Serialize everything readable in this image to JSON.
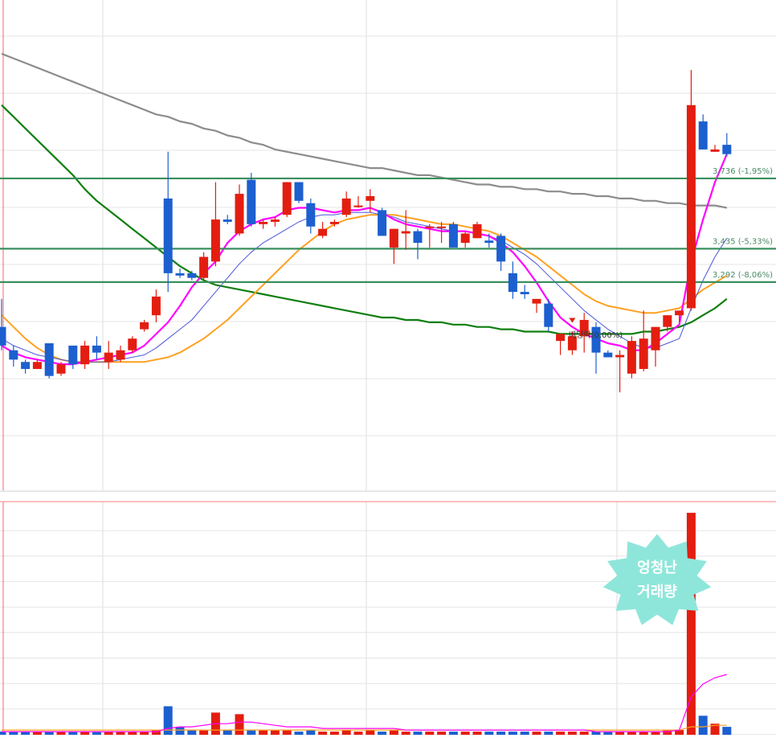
{
  "chart_data": [
    {
      "type": "candlestick",
      "title": "",
      "colors": {
        "up": "#e31e10",
        "down": "#1c5fcf",
        "ma_magenta": "#ff00ff",
        "ma_blue": "#4b55d8",
        "ma_orange": "#ffa020",
        "ma_green": "#0f7f0f",
        "ma_gray": "#8c8c8c",
        "level_line": "#3a8f5e"
      },
      "ohlc": [
        [
          3.1,
          3.22,
          3.0,
          3.02
        ],
        [
          3.0,
          3.02,
          2.93,
          2.96
        ],
        [
          2.95,
          2.96,
          2.9,
          2.92
        ],
        [
          2.92,
          2.96,
          2.92,
          2.95
        ],
        [
          3.03,
          3.03,
          2.88,
          2.89
        ],
        [
          2.9,
          2.95,
          2.89,
          2.94
        ],
        [
          3.02,
          3.02,
          2.92,
          2.94
        ],
        [
          2.94,
          3.04,
          2.92,
          3.02
        ],
        [
          3.02,
          3.06,
          2.96,
          2.99
        ],
        [
          2.95,
          3.04,
          2.92,
          2.99
        ],
        [
          2.96,
          3.02,
          2.95,
          3.0
        ],
        [
          3.0,
          3.06,
          2.99,
          3.05
        ],
        [
          3.09,
          3.13,
          3.08,
          3.12
        ],
        [
          3.15,
          3.26,
          3.12,
          3.23
        ],
        [
          3.65,
          3.85,
          3.25,
          3.33
        ],
        [
          3.33,
          3.35,
          3.31,
          3.32
        ],
        [
          3.33,
          3.34,
          3.3,
          3.31
        ],
        [
          3.31,
          3.42,
          3.3,
          3.4
        ],
        [
          3.38,
          3.72,
          3.36,
          3.56
        ],
        [
          3.56,
          3.58,
          3.54,
          3.55
        ],
        [
          3.5,
          3.71,
          3.49,
          3.67
        ],
        [
          3.73,
          3.76,
          3.53,
          3.54
        ],
        [
          3.54,
          3.56,
          3.52,
          3.55
        ],
        [
          3.55,
          3.57,
          3.53,
          3.56
        ],
        [
          3.58,
          3.72,
          3.57,
          3.72
        ],
        [
          3.72,
          3.72,
          3.63,
          3.64
        ],
        [
          3.63,
          3.65,
          3.5,
          3.53
        ],
        [
          3.49,
          3.55,
          3.48,
          3.52
        ],
        [
          3.54,
          3.56,
          3.53,
          3.55
        ],
        [
          3.58,
          3.68,
          3.57,
          3.65
        ],
        [
          3.62,
          3.66,
          3.61,
          3.62
        ],
        [
          3.64,
          3.69,
          3.59,
          3.66
        ],
        [
          3.6,
          3.61,
          3.53,
          3.49
        ],
        [
          3.44,
          3.52,
          3.37,
          3.52
        ],
        [
          3.5,
          3.6,
          3.43,
          3.51
        ],
        [
          3.51,
          3.52,
          3.39,
          3.46
        ],
        [
          3.53,
          3.54,
          3.44,
          3.53
        ],
        [
          3.53,
          3.55,
          3.46,
          3.53
        ],
        [
          3.54,
          3.55,
          3.45,
          3.44
        ],
        [
          3.46,
          3.51,
          3.44,
          3.5
        ],
        [
          3.48,
          3.55,
          3.48,
          3.54
        ],
        [
          3.47,
          3.5,
          3.44,
          3.46
        ],
        [
          3.49,
          3.5,
          3.34,
          3.38
        ],
        [
          3.33,
          3.38,
          3.22,
          3.25
        ],
        [
          3.25,
          3.28,
          3.22,
          3.24
        ],
        [
          3.2,
          3.22,
          3.16,
          3.22
        ],
        [
          3.2,
          3.22,
          3.08,
          3.1
        ],
        [
          3.04,
          3.07,
          2.98,
          3.07
        ],
        [
          3.0,
          3.08,
          2.98,
          3.06
        ],
        [
          3.06,
          3.16,
          2.99,
          3.13
        ],
        [
          3.1,
          3.12,
          2.9,
          2.99
        ],
        [
          2.99,
          3.0,
          2.97,
          2.97
        ],
        [
          2.97,
          3.0,
          2.82,
          2.98
        ],
        [
          2.9,
          3.06,
          2.88,
          3.04
        ],
        [
          2.92,
          3.17,
          2.91,
          3.05
        ],
        [
          3.0,
          3.09,
          2.93,
          3.1
        ],
        [
          3.1,
          3.15,
          3.08,
          3.15
        ],
        [
          3.15,
          3.17,
          3.12,
          3.17
        ],
        [
          3.18,
          4.2,
          3.17,
          4.05
        ],
        [
          3.98,
          4.01,
          3.86,
          3.86
        ],
        [
          3.85,
          3.88,
          3.85,
          3.86
        ],
        [
          3.88,
          3.93,
          3.83,
          3.84
        ]
      ],
      "moving_averages": {
        "ma_magenta": [
          3.02,
          2.99,
          2.97,
          2.96,
          2.95,
          2.94,
          2.94,
          2.95,
          2.96,
          2.97,
          2.98,
          2.99,
          3.02,
          3.07,
          3.12,
          3.19,
          3.27,
          3.33,
          3.38,
          3.46,
          3.51,
          3.54,
          3.56,
          3.57,
          3.6,
          3.61,
          3.61,
          3.6,
          3.59,
          3.6,
          3.6,
          3.61,
          3.59,
          3.56,
          3.54,
          3.53,
          3.52,
          3.51,
          3.51,
          3.51,
          3.5,
          3.49,
          3.46,
          3.42,
          3.36,
          3.29,
          3.21,
          3.14,
          3.1,
          3.07,
          3.05,
          3.03,
          3.02,
          3.0,
          3.0,
          3.03,
          3.07,
          3.11,
          3.38,
          3.56,
          3.72,
          3.84
        ],
        "ma_blue": [
          3.05,
          3.02,
          3.0,
          2.98,
          2.97,
          2.96,
          2.95,
          2.95,
          2.95,
          2.95,
          2.96,
          2.97,
          2.98,
          3.01,
          3.05,
          3.09,
          3.13,
          3.19,
          3.25,
          3.31,
          3.37,
          3.42,
          3.46,
          3.49,
          3.52,
          3.55,
          3.57,
          3.58,
          3.58,
          3.59,
          3.59,
          3.59,
          3.58,
          3.57,
          3.55,
          3.54,
          3.53,
          3.52,
          3.51,
          3.51,
          3.5,
          3.49,
          3.47,
          3.44,
          3.41,
          3.37,
          3.32,
          3.27,
          3.22,
          3.17,
          3.13,
          3.09,
          3.06,
          3.03,
          3.01,
          3.01,
          3.03,
          3.05,
          3.18,
          3.3,
          3.4,
          3.48
        ],
        "ma_orange": [
          3.15,
          3.1,
          3.05,
          3.01,
          2.98,
          2.96,
          2.95,
          2.95,
          2.95,
          2.95,
          2.95,
          2.95,
          2.95,
          2.96,
          2.97,
          2.99,
          3.02,
          3.05,
          3.09,
          3.13,
          3.18,
          3.23,
          3.28,
          3.33,
          3.38,
          3.43,
          3.47,
          3.51,
          3.54,
          3.56,
          3.57,
          3.58,
          3.58,
          3.58,
          3.57,
          3.56,
          3.55,
          3.54,
          3.54,
          3.53,
          3.52,
          3.51,
          3.49,
          3.46,
          3.43,
          3.4,
          3.36,
          3.32,
          3.28,
          3.24,
          3.21,
          3.19,
          3.18,
          3.17,
          3.16,
          3.16,
          3.17,
          3.18,
          3.22,
          3.26,
          3.29,
          3.32
        ],
        "ma_green": [
          4.05,
          4.0,
          3.95,
          3.9,
          3.85,
          3.8,
          3.75,
          3.69,
          3.64,
          3.6,
          3.56,
          3.52,
          3.48,
          3.44,
          3.4,
          3.36,
          3.33,
          3.3,
          3.28,
          3.27,
          3.26,
          3.25,
          3.24,
          3.23,
          3.22,
          3.21,
          3.2,
          3.19,
          3.18,
          3.17,
          3.16,
          3.15,
          3.14,
          3.14,
          3.13,
          3.13,
          3.12,
          3.12,
          3.11,
          3.11,
          3.1,
          3.1,
          3.09,
          3.09,
          3.08,
          3.08,
          3.08,
          3.07,
          3.07,
          3.07,
          3.07,
          3.07,
          3.07,
          3.07,
          3.08,
          3.08,
          3.09,
          3.1,
          3.12,
          3.15,
          3.18,
          3.22
        ],
        "ma_gray": [
          4.27,
          4.25,
          4.23,
          4.21,
          4.19,
          4.17,
          4.15,
          4.13,
          4.11,
          4.09,
          4.07,
          4.05,
          4.03,
          4.01,
          4.0,
          3.98,
          3.97,
          3.95,
          3.94,
          3.92,
          3.91,
          3.89,
          3.88,
          3.86,
          3.85,
          3.84,
          3.83,
          3.82,
          3.81,
          3.8,
          3.79,
          3.78,
          3.78,
          3.77,
          3.76,
          3.75,
          3.75,
          3.74,
          3.73,
          3.72,
          3.71,
          3.71,
          3.7,
          3.7,
          3.69,
          3.69,
          3.68,
          3.68,
          3.67,
          3.67,
          3.66,
          3.66,
          3.65,
          3.65,
          3.64,
          3.64,
          3.63,
          3.63,
          3.62,
          3.62,
          3.62,
          3.61
        ]
      },
      "horizontal_levels": [
        {
          "label": "3,736 (-1,95%)",
          "value": 3.736
        },
        {
          "label": "3,435 (-5,33%)",
          "value": 3.435
        },
        {
          "label": "3,292 (-8,06%)",
          "value": 3.292
        }
      ],
      "annotations": [
        {
          "text": "베당락(0,00%)"
        }
      ],
      "grid": true,
      "volume": {
        "values": [
          2,
          2,
          2,
          2,
          2,
          2,
          2,
          2,
          2,
          2,
          2,
          2,
          2,
          3,
          18,
          5,
          3,
          3,
          14,
          3,
          13,
          3,
          3,
          3,
          3,
          2,
          3,
          2,
          2,
          3,
          2,
          3,
          2,
          3,
          2,
          2,
          2,
          2,
          2,
          2,
          2,
          2,
          2,
          2,
          2,
          2,
          2,
          2,
          2,
          2,
          2,
          2,
          2,
          2,
          2,
          2,
          3,
          3,
          140,
          12,
          7,
          5
        ],
        "ma_magenta": [
          2,
          2,
          2,
          2,
          2,
          2,
          2,
          2,
          2,
          2,
          2,
          2,
          2,
          2,
          4,
          5,
          5,
          6,
          7,
          7,
          8,
          8,
          7,
          6,
          5,
          5,
          5,
          4,
          4,
          4,
          4,
          4,
          4,
          4,
          3,
          3,
          3,
          3,
          3,
          3,
          3,
          3,
          3,
          3,
          3,
          3,
          3,
          3,
          3,
          3,
          2,
          2,
          2,
          2,
          2,
          2,
          2,
          3,
          24,
          32,
          36,
          38
        ],
        "ma_orange": [
          3,
          3,
          3,
          3,
          3,
          3,
          3,
          3,
          3,
          3,
          3,
          3,
          3,
          3,
          3,
          3,
          3,
          3,
          3,
          3,
          3,
          3,
          3,
          3,
          3,
          3,
          3,
          3,
          3,
          3,
          3,
          3,
          3,
          3,
          3,
          3,
          3,
          3,
          3,
          3,
          3,
          3,
          3,
          3,
          3,
          3,
          3,
          3,
          3,
          3,
          3,
          3,
          3,
          3,
          3,
          3,
          3,
          3,
          5,
          5,
          6,
          6
        ]
      }
    }
  ],
  "badge": {
    "line1": "엉청난",
    "line2": "거래량"
  }
}
